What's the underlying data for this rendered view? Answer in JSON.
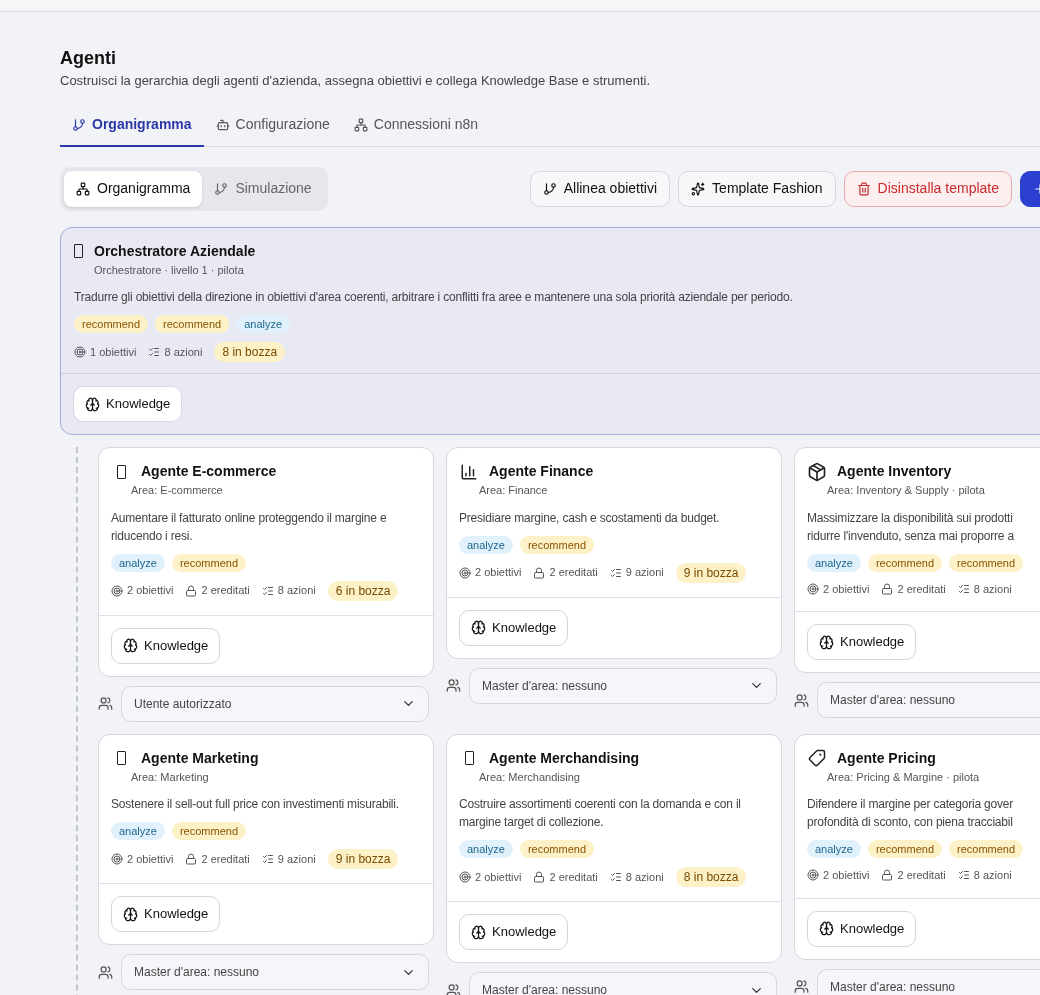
{
  "page": {
    "title": "Agenti",
    "subtitle": "Costruisci la gerarchia degli agenti d'azienda, assegna obiettivi e collega Knowledge Base e strumenti."
  },
  "tabs": [
    {
      "label": "Organigramma",
      "selected": true
    },
    {
      "label": "Configurazione",
      "selected": false
    },
    {
      "label": "Connessioni n8n",
      "selected": false
    }
  ],
  "view_toggle": [
    {
      "label": "Organigramma",
      "selected": true
    },
    {
      "label": "Simulazione",
      "selected": false
    }
  ],
  "actions": [
    {
      "label": "Allinea obiettivi",
      "kind": "default"
    },
    {
      "label": "Template Fashion",
      "kind": "default"
    },
    {
      "label": "Disinstalla template",
      "kind": "danger"
    },
    {
      "kind": "primary"
    }
  ],
  "orchestrator": {
    "name": "Orchestratore Aziendale",
    "subtitle": "Orchestratore · livello 1 · pilota",
    "description": "Tradurre gli obiettivi della direzione in obiettivi d'area coerenti, arbitrare i conflitti fra aree e mantenere una sola priorità aziendale per periodo.",
    "tags": [
      {
        "label": "recommend",
        "kind": "recommend"
      },
      {
        "label": "recommend",
        "kind": "recommend"
      },
      {
        "label": "analyze",
        "kind": "analyze"
      }
    ],
    "stats": {
      "objectives": "1 obiettivi",
      "actions": "8 azioni",
      "drafts": "8 in bozza"
    },
    "knowledge": "Knowledge"
  },
  "agents": [
    {
      "kind": "glyph",
      "name": "Agente E-commerce",
      "subtitle": "Area: E-commerce",
      "description": [
        "Aumentare il fatturato online proteggendo il margine e",
        "riducendo i resi."
      ],
      "tags": [
        {
          "label": "analyze",
          "kind": "analyze"
        },
        {
          "label": "recommend",
          "kind": "recommend"
        }
      ],
      "stats": {
        "objectives": "2 obiettivi",
        "inherited": "2 ereditati",
        "actions": "8 azioni",
        "drafts": "6 in bozza"
      },
      "knowledge": "Knowledge",
      "master": "Utente autorizzato"
    },
    {
      "kind": "chart",
      "name": "Agente Finance",
      "subtitle": "Area: Finance",
      "description": [
        "Presidiare margine, cash e scostamenti da budget."
      ],
      "tags": [
        {
          "label": "analyze",
          "kind": "analyze"
        },
        {
          "label": "recommend",
          "kind": "recommend"
        }
      ],
      "stats": {
        "objectives": "2 obiettivi",
        "inherited": "2 ereditati",
        "actions": "9 azioni",
        "drafts": "9 in bozza"
      },
      "knowledge": "Knowledge",
      "master": "Master d'area: nessuno"
    },
    {
      "kind": "box",
      "name": "Agente Inventory",
      "subtitle": "Area: Inventory & Supply · pilota",
      "description": [
        "Massimizzare la disponibilità sui prodotti",
        "ridurre l'invenduto, senza mai proporre a"
      ],
      "tags": [
        {
          "label": "analyze",
          "kind": "analyze"
        },
        {
          "label": "recommend",
          "kind": "recommend"
        },
        {
          "label": "recommend",
          "kind": "recommend"
        }
      ],
      "stats": {
        "objectives": "2 obiettivi",
        "inherited": "2 ereditati",
        "actions": "8 azioni"
      },
      "knowledge": "Knowledge",
      "master": "Master d'area: nessuno"
    },
    {
      "kind": "glyph",
      "name": "Agente Marketing",
      "subtitle": "Area: Marketing",
      "description": [
        "Sostenere il sell-out full price con investimenti misurabili."
      ],
      "tags": [
        {
          "label": "analyze",
          "kind": "analyze"
        },
        {
          "label": "recommend",
          "kind": "recommend"
        }
      ],
      "stats": {
        "objectives": "2 obiettivi",
        "inherited": "2 ereditati",
        "actions": "9 azioni",
        "drafts": "9 in bozza"
      },
      "knowledge": "Knowledge",
      "master": "Master d'area: nessuno"
    },
    {
      "kind": "glyph",
      "name": "Agente Merchandising",
      "subtitle": "Area: Merchandising",
      "description": [
        "Costruire assortimenti coerenti con la domanda e con il",
        "margine target di collezione."
      ],
      "tags": [
        {
          "label": "analyze",
          "kind": "analyze"
        },
        {
          "label": "recommend",
          "kind": "recommend"
        }
      ],
      "stats": {
        "objectives": "2 obiettivi",
        "inherited": "2 ereditati",
        "actions": "8 azioni",
        "drafts": "8 in bozza"
      },
      "knowledge": "Knowledge",
      "master": "Master d'area: nessuno"
    },
    {
      "kind": "tag",
      "name": "Agente Pricing",
      "subtitle": "Area: Pricing & Margine · pilota",
      "description": [
        "Difendere il margine per categoria gover",
        "profondità di sconto, con piena tracciabil"
      ],
      "tags": [
        {
          "label": "analyze",
          "kind": "analyze"
        },
        {
          "label": "recommend",
          "kind": "recommend"
        },
        {
          "label": "recommend",
          "kind": "recommend"
        }
      ],
      "stats": {
        "objectives": "2 obiettivi",
        "inherited": "2 ereditati",
        "actions": "8 azioni"
      },
      "knowledge": "Knowledge",
      "master": "Master d'area: nessuno"
    }
  ]
}
